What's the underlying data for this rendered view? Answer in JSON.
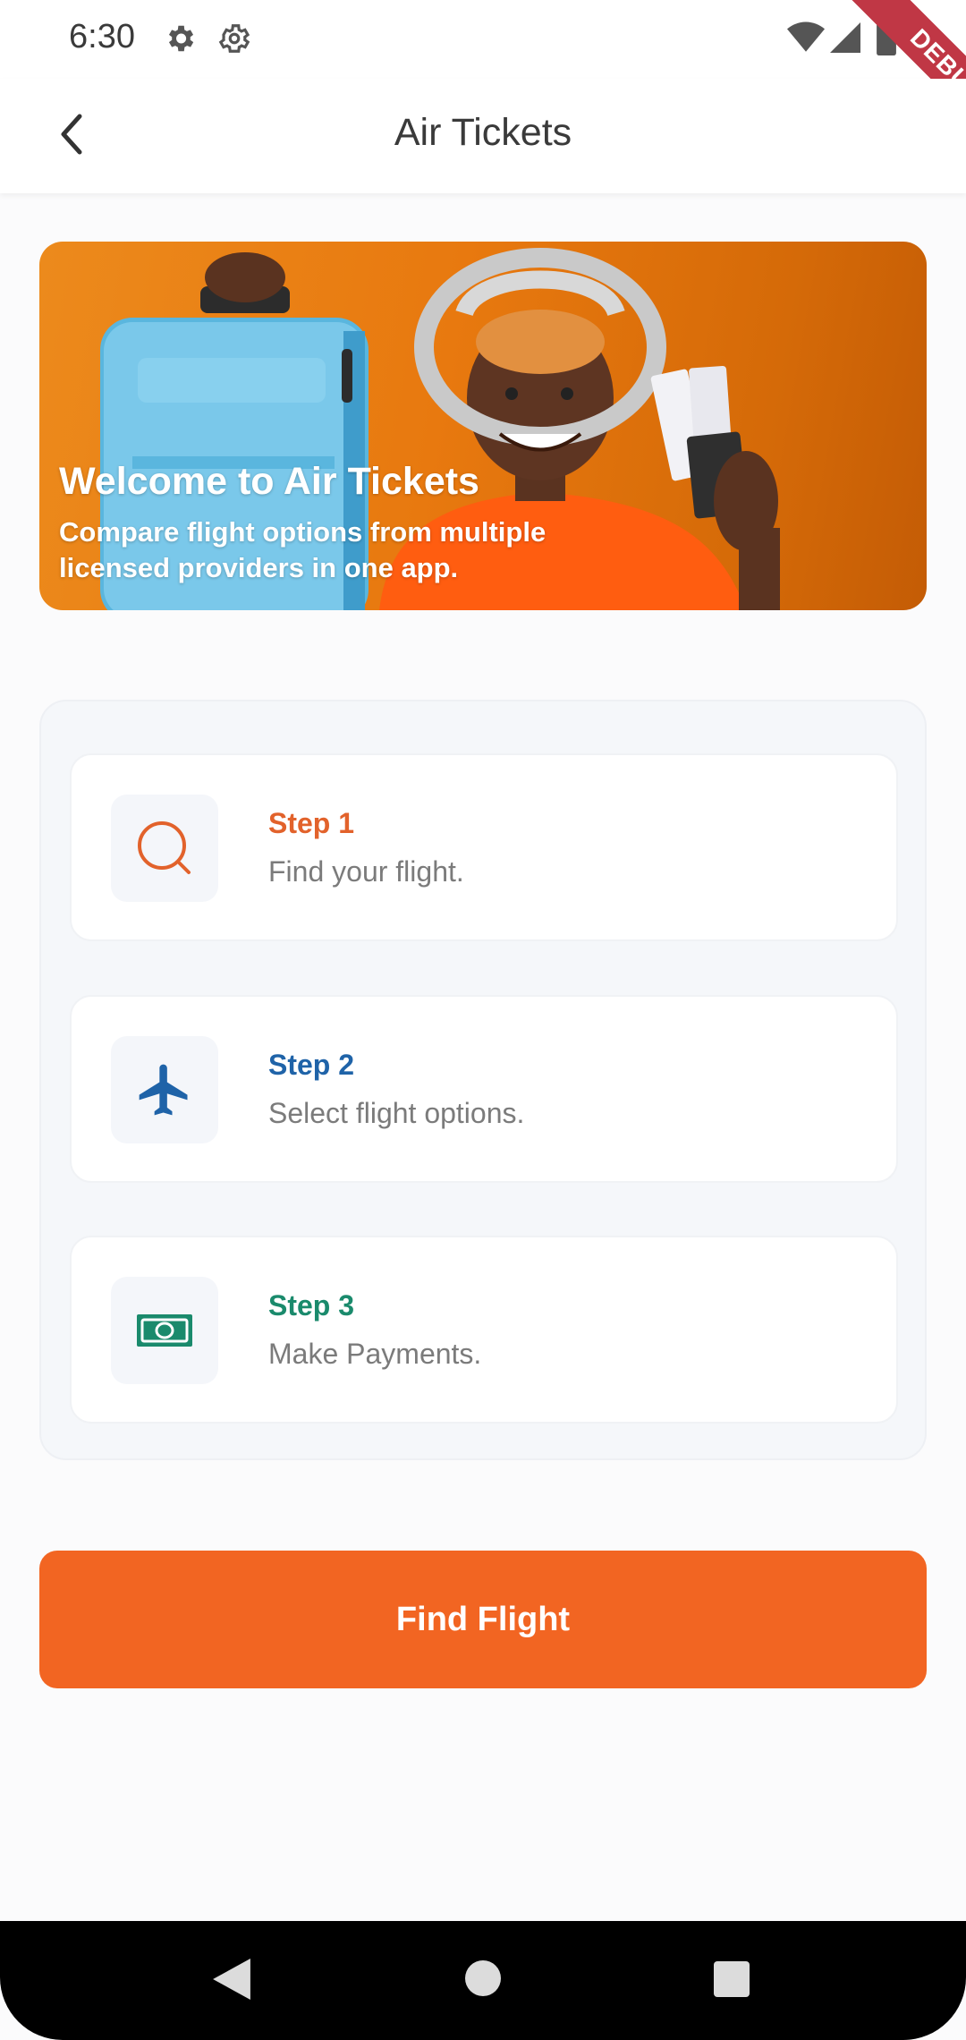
{
  "status_bar": {
    "time": "6:30",
    "icons": [
      "settings-gear-icon",
      "settings-outline-gear-icon",
      "wifi-icon",
      "cell-signal-icon",
      "battery-icon"
    ]
  },
  "debug_banner": "DEBUG",
  "app_bar": {
    "title": "Air Tickets",
    "back_icon": "chevron-left-icon"
  },
  "hero": {
    "title": "Welcome to Air Tickets",
    "subtitle": "Compare flight options from multiple licensed providers in one app."
  },
  "steps": [
    {
      "label": "Step 1",
      "description": "Find your flight.",
      "icon": "search-icon",
      "color": "#e2622b"
    },
    {
      "label": "Step 2",
      "description": "Select flight options.",
      "icon": "airplane-icon",
      "color": "#1f63a8"
    },
    {
      "label": "Step 3",
      "description": "Make Payments.",
      "icon": "money-bill-icon",
      "color": "#1a8a6c"
    }
  ],
  "primary_button": {
    "label": "Find Flight",
    "color": "#f26522"
  },
  "nav_bar": {
    "icons": [
      "nav-back-icon",
      "nav-home-icon",
      "nav-recents-icon"
    ]
  }
}
